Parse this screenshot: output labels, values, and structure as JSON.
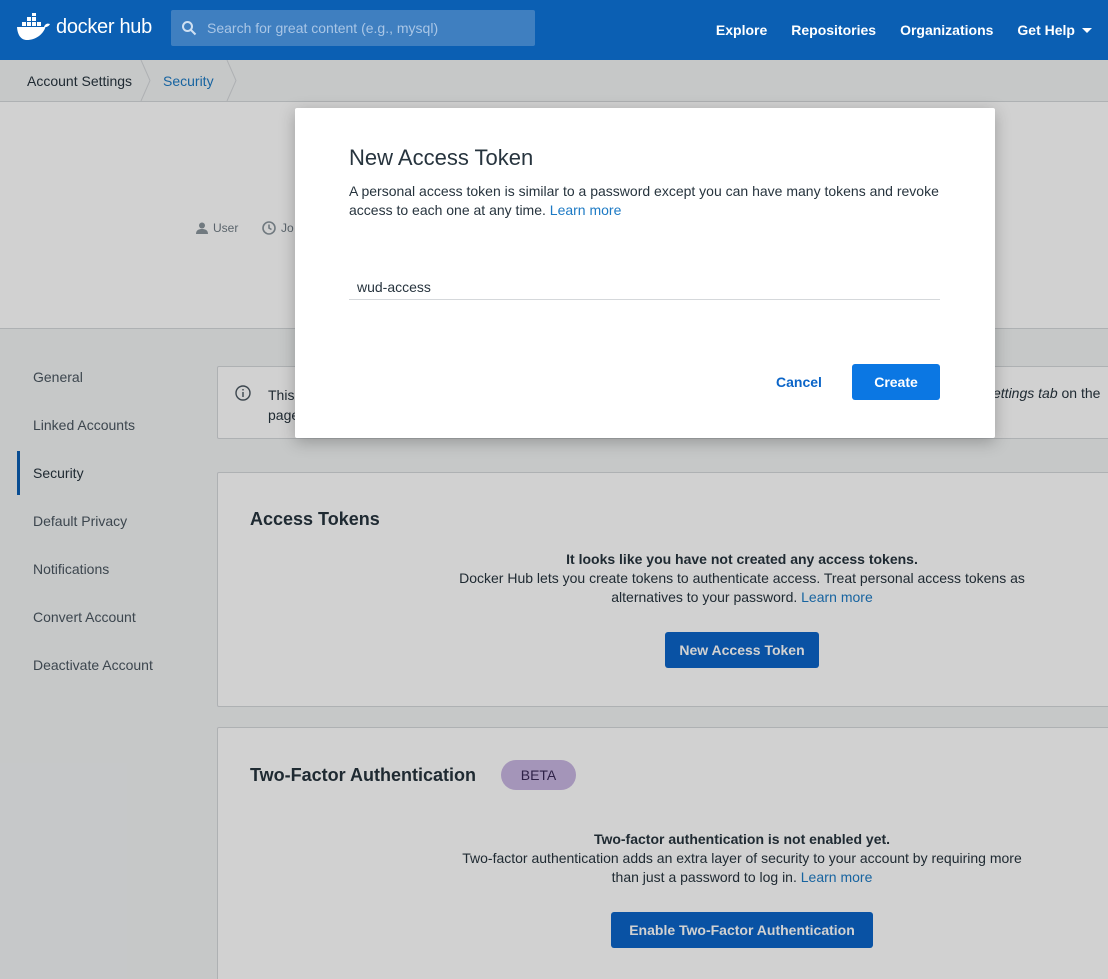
{
  "header": {
    "logo_text": "docker hub",
    "search": {
      "placeholder": "Search for great content (e.g., mysql)"
    },
    "nav": {
      "explore": "Explore",
      "repositories": "Repositories",
      "organizations": "Organizations",
      "get_help": "Get Help"
    }
  },
  "breadcrumb": {
    "items": [
      "Account Settings",
      "Security"
    ]
  },
  "profile": {
    "user_label": "User",
    "joined_label": "Jo"
  },
  "sidebar": {
    "items": [
      {
        "label": "General"
      },
      {
        "label": "Linked Accounts"
      },
      {
        "label": "Security",
        "active": true
      },
      {
        "label": "Default Privacy"
      },
      {
        "label": "Notifications"
      },
      {
        "label": "Convert Account"
      },
      {
        "label": "Deactivate Account"
      }
    ]
  },
  "notice": {
    "text_start": "This",
    "text_line2": "page",
    "settings_tab": "ettings tab",
    "on_the": " on the"
  },
  "access_tokens": {
    "title": "Access Tokens",
    "empty_heading": "It looks like you have not created any access tokens.",
    "empty_body": "Docker Hub lets you create tokens to authenticate access. Treat personal access tokens as alternatives to your password.",
    "learn_more": "Learn more",
    "button": "New Access Token"
  },
  "two_factor": {
    "title": "Two-Factor Authentication",
    "badge": "BETA",
    "empty_heading": "Two-factor authentication is not enabled yet.",
    "empty_body": "Two-factor authentication adds an extra layer of security to your account by requiring more than just a password to log in.",
    "learn_more": "Learn more",
    "button": "Enable Two-Factor Authentication"
  },
  "modal": {
    "title": "New Access Token",
    "description": "A personal access token is similar to a password except you can have many tokens and revoke access to each one at any time.",
    "learn_more": "Learn more",
    "input_value": "wud-access",
    "cancel": "Cancel",
    "create": "Create"
  },
  "colors": {
    "brand_blue": "#0b5fb3",
    "link_blue": "#1d7ac4",
    "button_blue": "#0b65c8",
    "beta_badge": "#c9b6e2"
  },
  "icons": {
    "logo": "docker-whale-icon",
    "search": "search-icon",
    "user": "user-icon",
    "clock": "clock-icon",
    "info": "info-icon",
    "caret": "chevron-down-icon"
  }
}
